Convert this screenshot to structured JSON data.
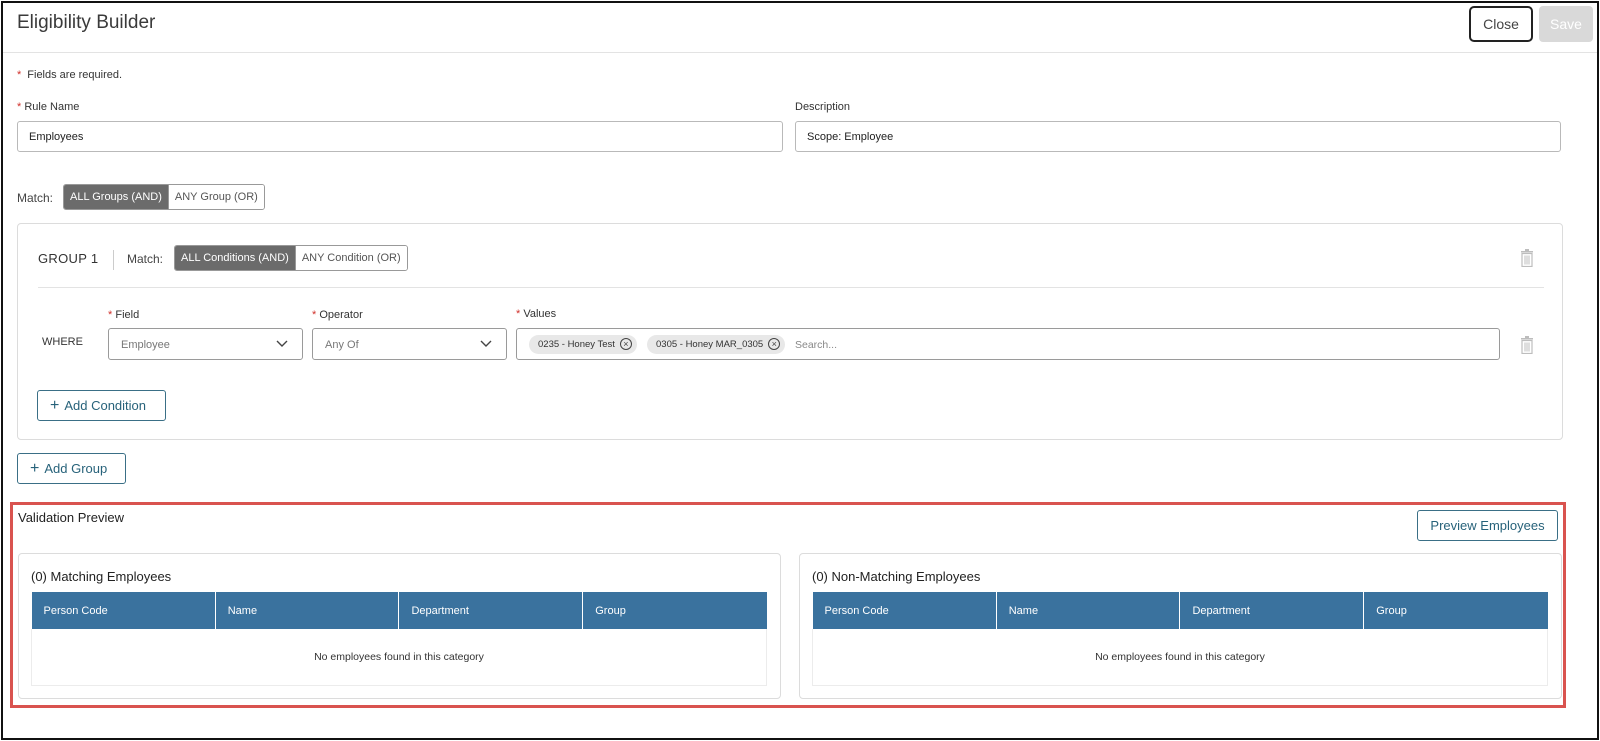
{
  "header": {
    "title": "Eligibility Builder",
    "close_label": "Close",
    "save_label": "Save"
  },
  "form": {
    "required_star": "*",
    "required_note": "Fields are required.",
    "rule_name_label": "Rule Name",
    "rule_name_value": "Employees",
    "description_label": "Description",
    "description_value": "Scope: Employee"
  },
  "match": {
    "label": "Match:",
    "options": [
      "ALL Groups (AND)",
      "ANY Group (OR)"
    ],
    "selected": "ALL Groups (AND)"
  },
  "group": {
    "title": "GROUP 1",
    "match_label": "Match:",
    "options": [
      "ALL Conditions (AND)",
      "ANY Condition (OR)"
    ],
    "selected": "ALL Conditions (AND)",
    "condition": {
      "where_label": "WHERE",
      "field_label": "Field",
      "field_value": "Employee",
      "operator_label": "Operator",
      "operator_value": "Any Of",
      "values_label": "Values",
      "chips": [
        "0235 - Honey Test",
        "0305 - Honey MAR_0305"
      ],
      "search_placeholder": "Search..."
    },
    "add_condition_label": "Add Condition",
    "plus": "+"
  },
  "add_group_label": "Add Group",
  "validation": {
    "title": "Validation Preview",
    "preview_button": "Preview Employees",
    "matching": {
      "title": "(0) Matching Employees",
      "columns": [
        "Person Code",
        "Name",
        "Department",
        "Group"
      ],
      "empty": "No employees found in this category"
    },
    "non_matching": {
      "title": "(0) Non-Matching Employees",
      "columns": [
        "Person Code",
        "Name",
        "Department",
        "Group"
      ],
      "empty": "No employees found in this category"
    }
  },
  "colors": {
    "accent": "#27627a",
    "table_header": "#3a729e",
    "highlight_border": "#d9534f",
    "required": "#d0302a"
  },
  "icons": {
    "trash": "trash-icon",
    "chevron": "chevron-down-icon",
    "chip_remove": "close-circle-icon",
    "plus": "plus-icon"
  }
}
